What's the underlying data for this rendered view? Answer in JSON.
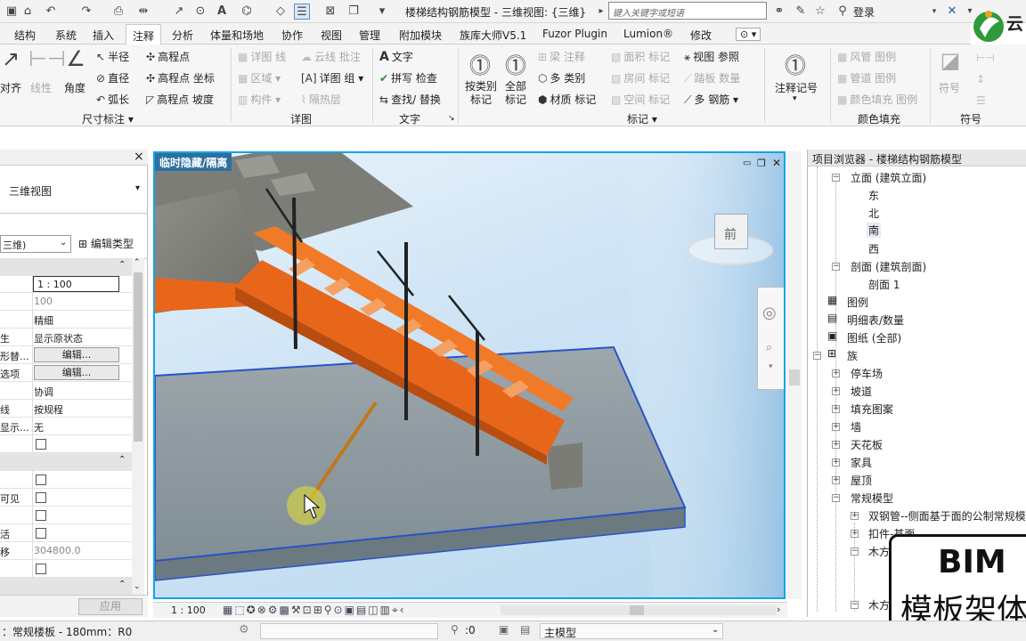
{
  "titlebar": {
    "document_title": "楼梯结构钢筋模型 - 三维视图: {三维}",
    "search_placeholder": "键入关键字或短语",
    "login_label": "登录",
    "brand_text": "云"
  },
  "menu": {
    "items": [
      "结构",
      "系统",
      "插入",
      "注释",
      "分析",
      "体量和场地",
      "协作",
      "视图",
      "管理",
      "附加模块",
      "族库大师V5.1",
      "Fuzor Plugin",
      "Lumion®",
      "修改",
      "⊙ ▾"
    ],
    "active_index": 3
  },
  "ribbon": {
    "dimension": {
      "aligned_label": "对齐",
      "linear_label": "线性",
      "angular_label": "角度",
      "radius_label": "半径",
      "diameter_label": "直径",
      "arc_length_label": "弧长",
      "spot_elevation_label": "高程点",
      "spot_coordinate_label": "高程点 坐标",
      "spot_slope_label": "高程点 坡度",
      "group_label": "尺寸标注 ▾"
    },
    "detail": {
      "detail_line_label": "详图 线",
      "region_label": "区域",
      "component_label": "构件",
      "revision_cloud_label": "云线 批注",
      "detail_group_label": "详图 组",
      "insulation_label": "隔热层",
      "group_label": "详图"
    },
    "text": {
      "text_label": "文字",
      "spelling_label": "拼写 检查",
      "find_replace_label": "查找/ 替换",
      "group_label": "文字"
    },
    "tag": {
      "tag_by_category_label": "按类别 标记",
      "tag_all_label": "全部 标记",
      "beam_annotation_label": "梁 注释",
      "multi_category_label": "多 类别",
      "material_tag_label": "材质 标记",
      "area_tag_label": "面积 标记",
      "room_tag_label": "房间 标记",
      "space_tag_label": "空间 标记",
      "view_reference_label": "视图 参照",
      "tread_number_label": "踏板 数量",
      "multi_rebar_label": "多 钢筋",
      "group_label": "标记 ▾"
    },
    "symbol_keynote": {
      "keynote_label": "注释记号"
    },
    "color_fill": {
      "duct_legend_label": "风管 图例",
      "pipe_legend_label": "管道 图例",
      "color_fill_legend_label": "颜色填充 图例",
      "group_label": "颜色填充"
    },
    "symbol": {
      "symbol_label": "符号",
      "group_label": "符号"
    }
  },
  "properties": {
    "close_icon": "×",
    "type_name": "三维视图",
    "view_selector": "三维)",
    "edit_type_label": "编辑类型",
    "rows": [
      {
        "key": "",
        "value": "1 : 100"
      },
      {
        "key": "",
        "value": "100"
      },
      {
        "key": "",
        "value": "精细"
      },
      {
        "key": "生",
        "value": "显示原状态"
      },
      {
        "key": "形替...",
        "value": "编辑..."
      },
      {
        "key": "选项",
        "value": "编辑..."
      },
      {
        "key": "",
        "value": "协调"
      },
      {
        "key": "线",
        "value": "按规程"
      },
      {
        "key": "显示...",
        "value": "无"
      },
      {
        "key": "",
        "value": ""
      },
      {
        "key": "",
        "value": ""
      },
      {
        "key": "可见",
        "value": ""
      },
      {
        "key": "",
        "value": ""
      },
      {
        "key": "活",
        "value": ""
      },
      {
        "key": "移",
        "value": "304800.0"
      },
      {
        "key": "",
        "value": ""
      }
    ],
    "apply_label": "应用"
  },
  "viewport": {
    "label": "临时隐藏/隔离",
    "viewcube_face": "前",
    "scale_label": "1 : 100"
  },
  "browser": {
    "title": "项目浏览器 - 楼梯结构钢筋模型",
    "items": [
      {
        "label": "立面 (建筑立面)",
        "level": 1,
        "toggle": "−"
      },
      {
        "label": "东",
        "level": 2,
        "toggle": ""
      },
      {
        "label": "北",
        "level": 2,
        "toggle": ""
      },
      {
        "label": "南",
        "level": 2,
        "toggle": "",
        "selected": true
      },
      {
        "label": "西",
        "level": 2,
        "toggle": ""
      },
      {
        "label": "剖面 (建筑剖面)",
        "level": 1,
        "toggle": "−"
      },
      {
        "label": "剖面 1",
        "level": 2,
        "toggle": ""
      },
      {
        "label": "图例",
        "level": 0,
        "toggle": ""
      },
      {
        "label": "明细表/数量",
        "level": 0,
        "toggle": ""
      },
      {
        "label": "图纸 (全部)",
        "level": 0,
        "toggle": ""
      },
      {
        "label": "族",
        "level": 0,
        "toggle": "−"
      },
      {
        "label": "停车场",
        "level": 1,
        "toggle": "+"
      },
      {
        "label": "坡道",
        "level": 1,
        "toggle": "+"
      },
      {
        "label": "填充图案",
        "level": 1,
        "toggle": "+"
      },
      {
        "label": "墙",
        "level": 1,
        "toggle": "+"
      },
      {
        "label": "天花板",
        "level": 1,
        "toggle": "+"
      },
      {
        "label": "家具",
        "level": 1,
        "toggle": "+"
      },
      {
        "label": "屋顶",
        "level": 1,
        "toggle": "+"
      },
      {
        "label": "常规模型",
        "level": 1,
        "toggle": "−"
      },
      {
        "label": "双钢管--侧面基于面的公制常规模",
        "level": 2,
        "toggle": "+"
      },
      {
        "label": "扣件-基面",
        "level": 2,
        "toggle": "+"
      },
      {
        "label": "木方",
        "level": 2,
        "toggle": "−"
      },
      {
        "label": "",
        "level": 3,
        "toggle": ""
      },
      {
        "label": "木方",
        "level": 2,
        "toggle": "−"
      }
    ]
  },
  "statusbar": {
    "selection_text": "：常规楼板 - 180mm：R0",
    "filter_count": ":0",
    "model_label": "主模型"
  },
  "watermark": {
    "line1": "BIM",
    "line2": "模板架体"
  },
  "colors": {
    "viewport_border": "#12a5e3",
    "label_bg": "#2e6fa0",
    "beam_orange": "#e8661a"
  }
}
